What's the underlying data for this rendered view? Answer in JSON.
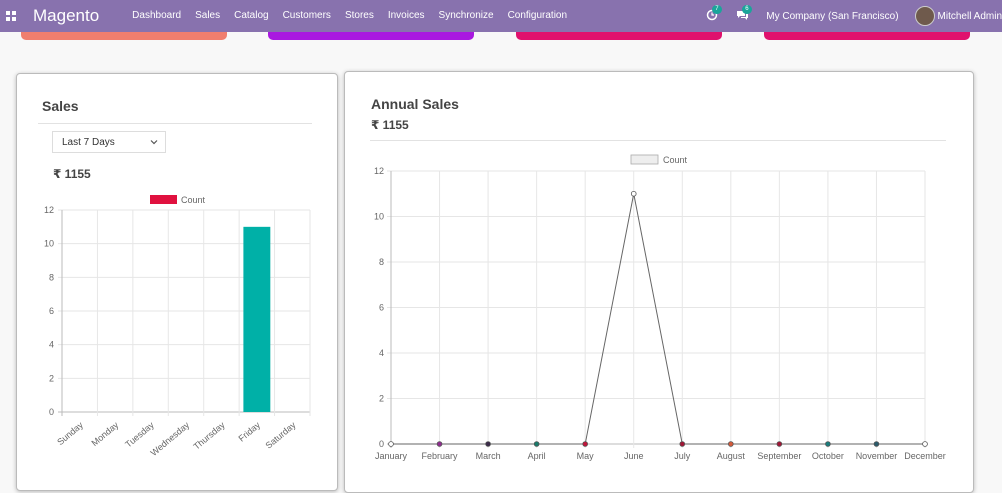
{
  "navbar": {
    "brand": "Magento",
    "menu": [
      "Dashboard",
      "Sales",
      "Catalog",
      "Customers",
      "Stores",
      "Invoices",
      "Synchronize",
      "Configuration"
    ],
    "activity_count": "7",
    "message_count": "6",
    "company": "My Company (San Francisco)",
    "user": "Mitchell Admin",
    "background_color": "#8872ae"
  },
  "stat_cards": [
    {
      "color": "#f07e6e"
    },
    {
      "color": "#a919e0"
    },
    {
      "color": "#e0116d"
    },
    {
      "color": "#e0116d"
    }
  ],
  "sales_panel": {
    "title": "Sales",
    "period_select": "Last 7 Days",
    "amount": "₹ 1155"
  },
  "annual_panel": {
    "title": "Annual Sales",
    "amount": "₹ 1155"
  },
  "chart_data": [
    {
      "type": "bar",
      "legend": [
        "Count"
      ],
      "legend_color": "#e0113f",
      "categories": [
        "Sunday",
        "Monday",
        "Tuesday",
        "Wednesday",
        "Thursday",
        "Friday",
        "Saturday"
      ],
      "series": [
        {
          "name": "Count",
          "values": [
            0,
            0,
            0,
            0,
            0,
            11,
            0
          ]
        }
      ],
      "bar_color": "#00b0a7",
      "y_ticks": [
        "0",
        "2",
        "4",
        "6",
        "8",
        "10",
        "12"
      ],
      "ylim": [
        0,
        12
      ],
      "grid": true,
      "legend_position": "top"
    },
    {
      "type": "line",
      "legend": [
        "Count"
      ],
      "categories": [
        "January",
        "February",
        "March",
        "April",
        "May",
        "June",
        "July",
        "August",
        "September",
        "October",
        "November",
        "December"
      ],
      "series": [
        {
          "name": "Count",
          "values": [
            0,
            0,
            0,
            0,
            0,
            11,
            0,
            0,
            0,
            0,
            0,
            0
          ]
        }
      ],
      "point_colors": [
        "#ffffff",
        "#8e2c8e",
        "#3a2a48",
        "#1a7a6a",
        "#c0153a",
        "#ffffff",
        "#a01535",
        "#d45a3a",
        "#a01535",
        "#1a7a7a",
        "#2a5a6a",
        "#ffffff"
      ],
      "y_ticks": [
        "0",
        "2",
        "4",
        "6",
        "8",
        "10",
        "12"
      ],
      "ylim": [
        0,
        12
      ],
      "grid": true,
      "legend_position": "top"
    }
  ]
}
